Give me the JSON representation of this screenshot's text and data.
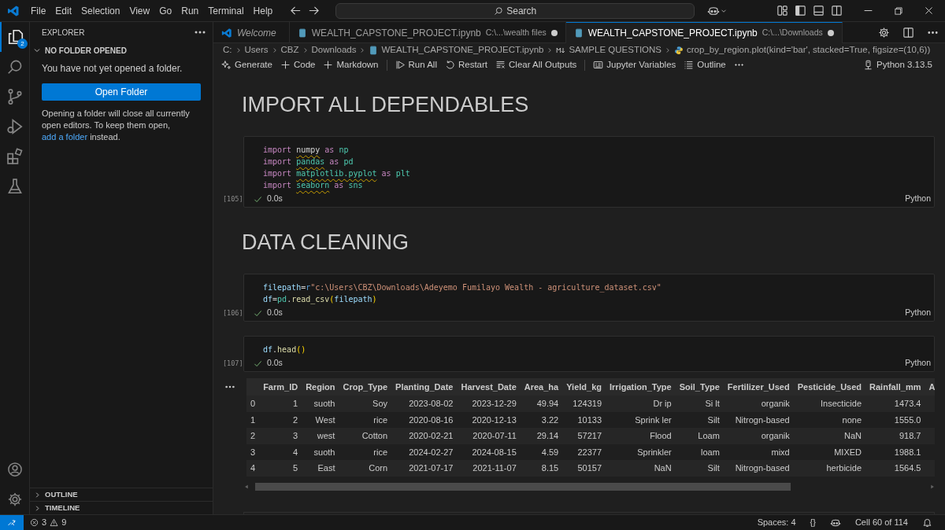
{
  "title_bar": {
    "menus": [
      "File",
      "Edit",
      "Selection",
      "View",
      "Go",
      "Run",
      "Terminal",
      "Help"
    ],
    "search": {
      "placeholder": "Search"
    }
  },
  "activity_bar": {
    "items": [
      {
        "selected": true,
        "badge": "2"
      },
      {
        "selected": false
      },
      {
        "selected": false
      },
      {
        "selected": false
      },
      {
        "selected": false
      },
      {
        "selected": false
      }
    ]
  },
  "sidebar": {
    "title": "EXPLORER",
    "section": {
      "title": "NO FOLDER OPENED",
      "expanded": true,
      "message": "You have not yet opened a folder.",
      "button": "Open Folder",
      "note_before": "Opening a folder will close all currently open editors. To keep them open,",
      "note_link": "add a folder",
      "note_after": "instead."
    },
    "collapsed_sections": [
      {
        "title": "OUTLINE",
        "expanded": false
      },
      {
        "title": "TIMELINE",
        "expanded": false
      }
    ]
  },
  "tabs": [
    {
      "kind": "welcome",
      "label": "Welcome",
      "selected": false,
      "dirty": false
    },
    {
      "kind": "notebook",
      "label": "WEALTH_CAPSTONE_PROJECT.ipynb",
      "description": "C:\\...\\wealth files",
      "selected": false,
      "dirty": true
    },
    {
      "kind": "notebook",
      "label": "WEALTH_CAPSTONE_PROJECT.ipynb",
      "description": "C:\\...\\Downloads",
      "selected": true,
      "dirty": true
    }
  ],
  "breadcrumbs": [
    {
      "kind": "folder",
      "label": "C:"
    },
    {
      "kind": "folder",
      "label": "Users"
    },
    {
      "kind": "folder",
      "label": "CBZ"
    },
    {
      "kind": "folder",
      "label": "Downloads"
    },
    {
      "kind": "notebook",
      "label": "WEALTH_CAPSTONE_PROJECT.ipynb"
    },
    {
      "kind": "markdown",
      "label": "SAMPLE QUESTIONS"
    },
    {
      "kind": "python",
      "label": "crop_by_region.plot(kind='bar', stacked=True, figsize=(10,6))"
    }
  ],
  "toolbar": {
    "groups": [
      [
        {
          "kind": "sparkle",
          "label": "Generate"
        },
        {
          "kind": "plus",
          "label": "Code"
        },
        {
          "kind": "plus",
          "label": "Markdown"
        }
      ],
      [
        {
          "kind": "run",
          "label": "Run All"
        },
        {
          "kind": "restart",
          "label": "Restart"
        },
        {
          "kind": "clear",
          "label": "Clear All Outputs"
        }
      ],
      [
        {
          "kind": "variables",
          "label": "Jupyter Variables"
        },
        {
          "kind": "outline",
          "label": "Outline"
        },
        {
          "kind": "more"
        }
      ]
    ],
    "kernel": "Python 3.13.5"
  },
  "cells": [
    {
      "kind": "markdown",
      "text": "IMPORT ALL DEPENDABLES"
    },
    {
      "kind": "code",
      "count": "[105]",
      "success": true,
      "duration": "0.0s",
      "language": "Python",
      "lines": [
        [
          {
            "text": "import",
            "kind": "kw"
          },
          {
            "text": "numpy",
            "kind": "plain",
            "sp": true,
            "squiggle": true
          },
          {
            "text": "as",
            "kind": "kw",
            "sp": true
          },
          {
            "text": "np",
            "kind": "mod",
            "sp": true
          }
        ],
        [
          {
            "text": "import",
            "kind": "kw"
          },
          {
            "text": "pandas",
            "kind": "mod",
            "sp": true,
            "squiggle": true
          },
          {
            "text": "as",
            "kind": "kw",
            "sp": true
          },
          {
            "text": "pd",
            "kind": "mod",
            "sp": true
          }
        ],
        [
          {
            "text": "import",
            "kind": "kw"
          },
          {
            "text": "matplotlib.pyplot",
            "kind": "mod",
            "sp": true,
            "squiggle": true
          },
          {
            "text": "as",
            "kind": "kw",
            "sp": true
          },
          {
            "text": "plt",
            "kind": "mod",
            "sp": true
          }
        ],
        [
          {
            "text": "import",
            "kind": "kw"
          },
          {
            "text": "seaborn",
            "kind": "mod",
            "sp": true,
            "squiggle": true
          },
          {
            "text": "as",
            "kind": "kw",
            "sp": true
          },
          {
            "text": "sns",
            "kind": "mod",
            "sp": true
          }
        ]
      ]
    },
    {
      "kind": "markdown",
      "text": "DATA CLEANING"
    },
    {
      "kind": "code",
      "count": "[106]",
      "success": true,
      "duration": "0.0s",
      "language": "Python",
      "lines": [
        [
          {
            "text": "filepath",
            "kind": "var"
          },
          {
            "text": "=",
            "kind": "op"
          },
          {
            "text": "r",
            "kind": "prefix"
          },
          {
            "text": "\"c:\\Users\\CBZ\\Downloads\\Adeyemo Fumilayo Wealth - agriculture_dataset.csv\"",
            "kind": "str"
          }
        ],
        [
          {
            "text": "df",
            "kind": "var"
          },
          {
            "text": "=",
            "kind": "op"
          },
          {
            "text": "pd",
            "kind": "mod"
          },
          {
            "text": ".",
            "kind": "op"
          },
          {
            "text": "read_csv",
            "kind": "fn"
          },
          {
            "text": "(",
            "kind": "paren"
          },
          {
            "text": "filepath",
            "kind": "var"
          },
          {
            "text": ")",
            "kind": "paren"
          }
        ]
      ]
    },
    {
      "kind": "code",
      "count": "[107]",
      "success": true,
      "duration": "0.0s",
      "language": "Python",
      "lines": [
        [
          {
            "text": "df",
            "kind": "var"
          },
          {
            "text": ".",
            "kind": "op"
          },
          {
            "text": "head",
            "kind": "fn"
          },
          {
            "text": "()",
            "kind": "paren"
          }
        ]
      ],
      "output": {
        "columns": [
          "",
          "Farm_ID",
          "Region",
          "Crop_Type",
          "Planting_Date",
          "Harvest_Date",
          "Area_ha",
          "Yield_kg",
          "Irrigation_Type",
          "Soil_Type",
          "Fertilizer_Used",
          "Pesticide_Used",
          "Rainfall_mm",
          "A"
        ],
        "rows": [
          [
            "0",
            "1",
            "suoth",
            "Soy",
            "2023-08-02",
            "2023-12-29",
            "49.94",
            "124319",
            "Dr ip",
            "Si lt",
            "organik",
            "Insecticide",
            "1473.4"
          ],
          [
            "1",
            "2",
            "West",
            "rice",
            "2020-08-16",
            "2020-12-13",
            "3.22",
            "10133",
            "Sprink ler",
            "Silt",
            "Nitrogn-based",
            "none",
            "1555.0"
          ],
          [
            "2",
            "3",
            "west",
            "Cotton",
            "2020-02-21",
            "2020-07-11",
            "29.14",
            "57217",
            "Flood",
            "Loam",
            "organik",
            "NaN",
            "918.7"
          ],
          [
            "3",
            "4",
            "suoth",
            "rice",
            "2024-02-27",
            "2024-08-15",
            "4.59",
            "22377",
            "Sprinkler",
            "loam",
            "mixd",
            "MIXED",
            "1988.1"
          ],
          [
            "4",
            "5",
            "East",
            "Corn",
            "2021-07-17",
            "2021-11-07",
            "8.15",
            "50157",
            "NaN",
            "Silt",
            "Nitrogn-based",
            "herbicide",
            "1564.5"
          ]
        ]
      }
    }
  ],
  "status_bar": {
    "errors": "3",
    "warnings": "9",
    "items": [
      {
        "kind": "text",
        "label": "Spaces: 4"
      },
      {
        "kind": "text",
        "label": "{}"
      },
      {
        "kind": "copilot"
      },
      {
        "kind": "text",
        "label": "Cell 60 of 114"
      },
      {
        "kind": "bell"
      }
    ]
  }
}
